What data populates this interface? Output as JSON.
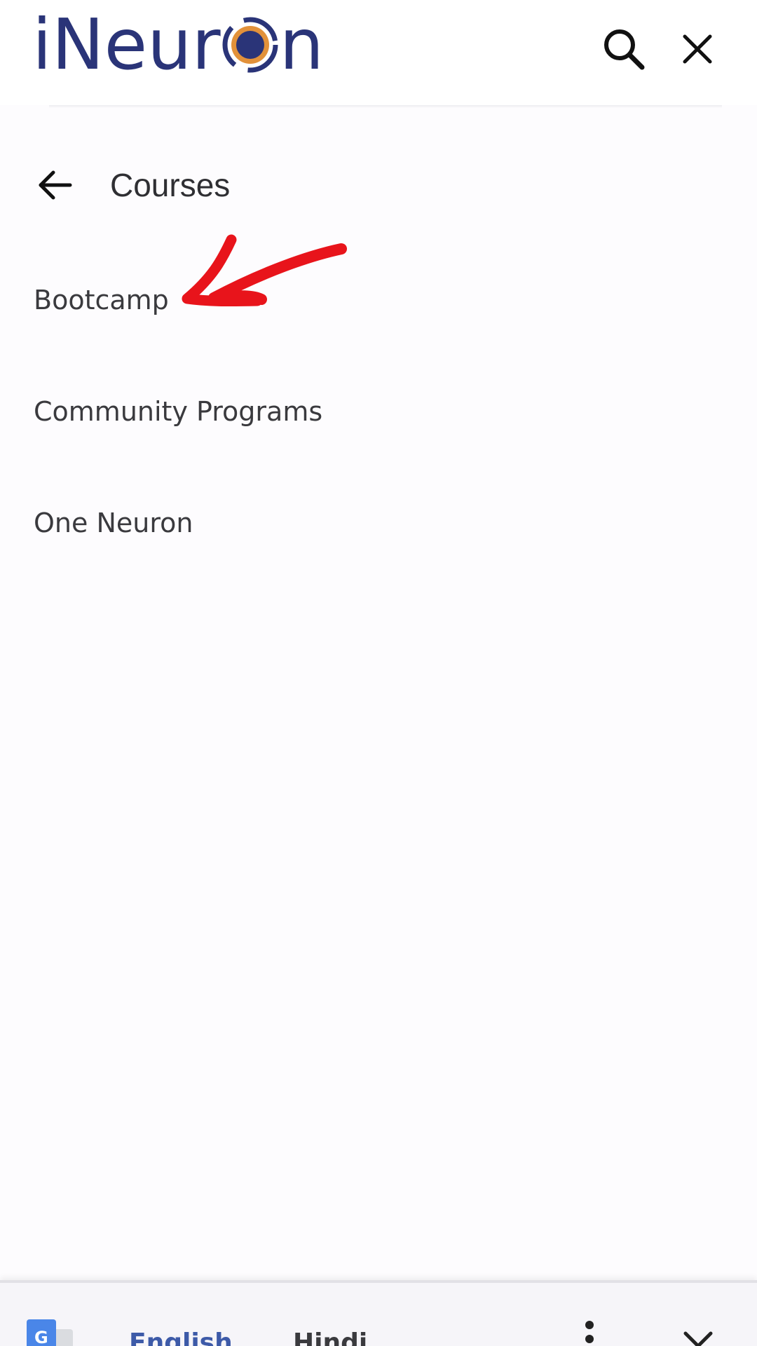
{
  "header": {
    "logo": {
      "prefix": "iNeur",
      "suffix": "n",
      "brand_colors": {
        "text": "#2a3478",
        "ring": "#e2913a"
      }
    },
    "search_icon": "search-icon",
    "close_icon": "close-icon"
  },
  "nav": {
    "back_icon": "arrow-left-icon",
    "title": "Courses"
  },
  "menu": {
    "items": [
      {
        "label": "Bootcamp"
      },
      {
        "label": "Community Programs"
      },
      {
        "label": "One Neuron"
      }
    ]
  },
  "annotation": {
    "arrow_color": "#e8141b"
  },
  "translate_bar": {
    "icon": "google-translate-icon",
    "languages": [
      "English",
      "Hindi"
    ],
    "selected": "English",
    "more_icon": "more-vertical-icon",
    "close_icon": "close-icon"
  }
}
